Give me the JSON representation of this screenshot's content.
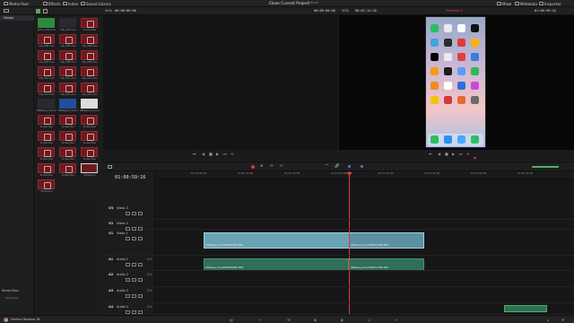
{
  "topbar": {
    "left_items": [
      "Media Pool",
      "Effects",
      "Index",
      "Sound Library"
    ],
    "project_title": "Clone Current Project",
    "project_status": "Edited",
    "right_items": [
      "Mixer",
      "Metadata",
      "Inspector"
    ]
  },
  "viewer_bar": {
    "src_zoom": "50%",
    "src_timecode_left": "00:00:00:00",
    "src_timecode_right": "00:00:00:00",
    "tl_zoom": "50%",
    "tl_duration": "00:01:14:10",
    "tl_name": "Timeline 1",
    "tl_timecode": "01:00:59:16"
  },
  "bins": {
    "master_label": "Master",
    "smart_bins_label": "Smart Bins",
    "keywords_label": "Keywords"
  },
  "media_thumbs": [
    {
      "label": "green_Clip.mov",
      "color": "green"
    },
    {
      "label": "Clip_003.mov",
      "color": "dark"
    },
    {
      "label": "Screen Rec",
      "color": "red"
    },
    {
      "label": "Clip_004.mov",
      "color": "red"
    },
    {
      "label": "Clip_005.mov",
      "color": "red"
    },
    {
      "label": "Clip_006.mov",
      "color": "red"
    },
    {
      "label": "Clip_007.mov",
      "color": "red"
    },
    {
      "label": "Clip_008.mov",
      "color": "red"
    },
    {
      "label": "Clip_009.mov",
      "color": "red"
    },
    {
      "label": "Clip_010.mov",
      "color": "red"
    },
    {
      "label": "Clip_011.mov",
      "color": "red"
    },
    {
      "label": "Clip_012.mov",
      "color": "red"
    },
    {
      "label": "Clip_013.mov",
      "color": "red"
    },
    {
      "label": "Clip_014.mov",
      "color": "red"
    },
    {
      "label": "Clip_015.mov",
      "color": "red"
    },
    {
      "label": "RPReplay_Final.mp4",
      "color": "dark"
    },
    {
      "label": "RPReplay_Final.mp4",
      "color": "blue"
    },
    {
      "label": "RPReplay_Final.mp4",
      "color": "white"
    },
    {
      "label": "Screen Rec",
      "color": "red"
    },
    {
      "label": "Screen Rec",
      "color": "red"
    },
    {
      "label": "Screen Rec",
      "color": "red"
    },
    {
      "label": "Screen Rec",
      "color": "red"
    },
    {
      "label": "Screen Rec",
      "color": "red"
    },
    {
      "label": "Screen Rec",
      "color": "red"
    },
    {
      "label": "Screen Rec",
      "color": "red"
    },
    {
      "label": "Screen Rec",
      "color": "red"
    },
    {
      "label": "Screen Rec",
      "color": "red"
    },
    {
      "label": "Screen Rec",
      "color": "red"
    },
    {
      "label": "Screen Rec",
      "color": "red"
    },
    {
      "label": "Timeline 1",
      "color": "timeline"
    },
    {
      "label": "Timeline 2",
      "color": "red"
    }
  ],
  "timeline": {
    "timecode": "01:00:59:16",
    "ruler_labels": [
      "01:00:00:00",
      "01:00:20:00",
      "01:00:40:00",
      "01:01:00:00",
      "01:01:20:00",
      "01:01:40:00",
      "01:02:00:00",
      "01:02:20:00"
    ],
    "tracks": [
      {
        "id": "V3",
        "name": "Video 3"
      },
      {
        "id": "V2",
        "name": "Video 2"
      },
      {
        "id": "V1",
        "name": "Video 1"
      },
      {
        "id": "A1",
        "name": "Audio 1",
        "level": "2.0"
      },
      {
        "id": "A2",
        "name": "Audio 2",
        "level": "2.0"
      },
      {
        "id": "A3",
        "name": "Audio 3",
        "level": "2.0"
      },
      {
        "id": "A4",
        "name": "Audio 4",
        "level": "2.0"
      }
    ],
    "clips": {
      "video_1_name": "RPReplay_Final1688309856.MP4",
      "video_2_name": "RPReplay_Final1688317386.MP4",
      "audio_1_name": "RPReplay_Final1688309856.MP4",
      "audio_2_name": "RPReplay_Final1688317386.MP4"
    }
  },
  "bottombar": {
    "app_name": "DaVinci Resolve 18"
  },
  "colors": {
    "playhead": "#e2383d",
    "video_clip": "#6aa2b5",
    "audio_clip": "#2f6e58",
    "media_thumb_red": "#6c1a1e"
  }
}
